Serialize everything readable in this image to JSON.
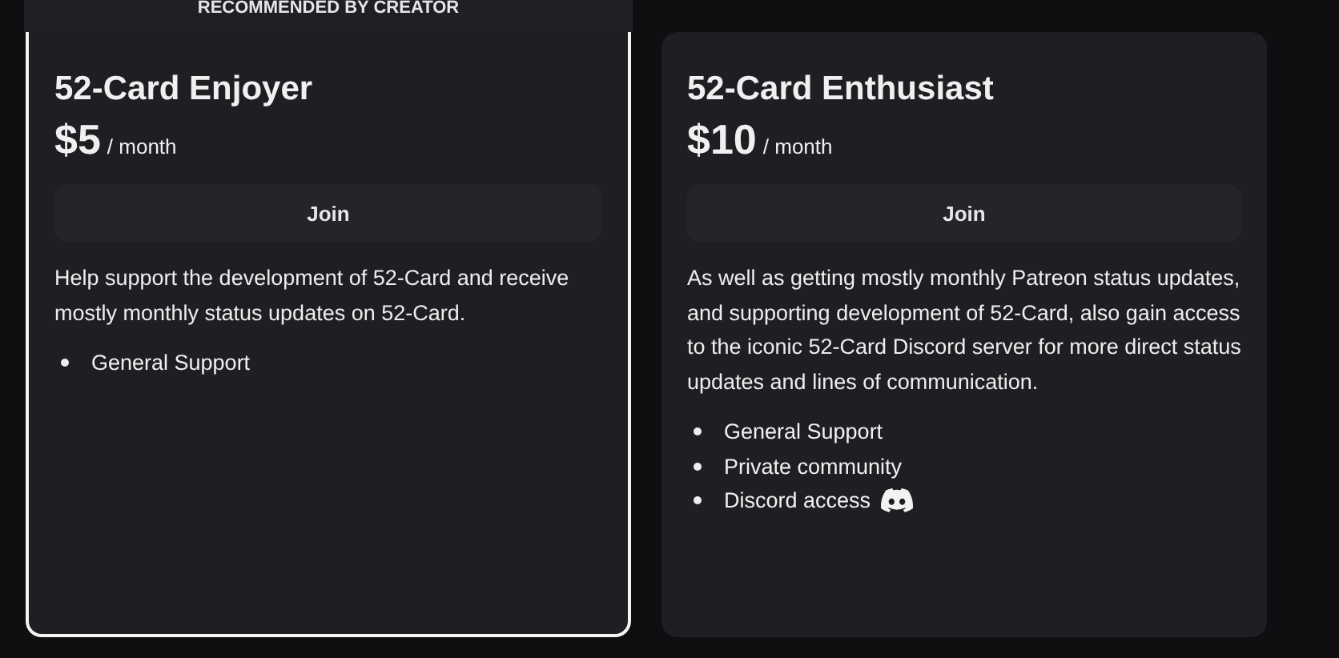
{
  "tiers": [
    {
      "badge": "RECOMMENDED BY CREATOR",
      "recommended": true,
      "name": "52-Card Enjoyer",
      "price": "$5",
      "period": "/ month",
      "button": "Join",
      "description": "Help support the development of 52-Card and receive mostly monthly status updates on 52-Card.",
      "benefits": [
        {
          "kind": "text",
          "label": "General Support"
        }
      ]
    },
    {
      "recommended": false,
      "name": "52-Card Enthusiast",
      "price": "$10",
      "period": "/ month",
      "button": "Join",
      "description": "As well as getting mostly monthly Patreon status updates, and supporting development of 52-Card, also gain access to the iconic 52-Card Discord server for more direct status updates and lines of communication.",
      "benefits": [
        {
          "kind": "text",
          "label": "General Support"
        },
        {
          "kind": "text",
          "label": "Private community"
        },
        {
          "kind": "icon",
          "label": "Discord access"
        }
      ]
    }
  ]
}
